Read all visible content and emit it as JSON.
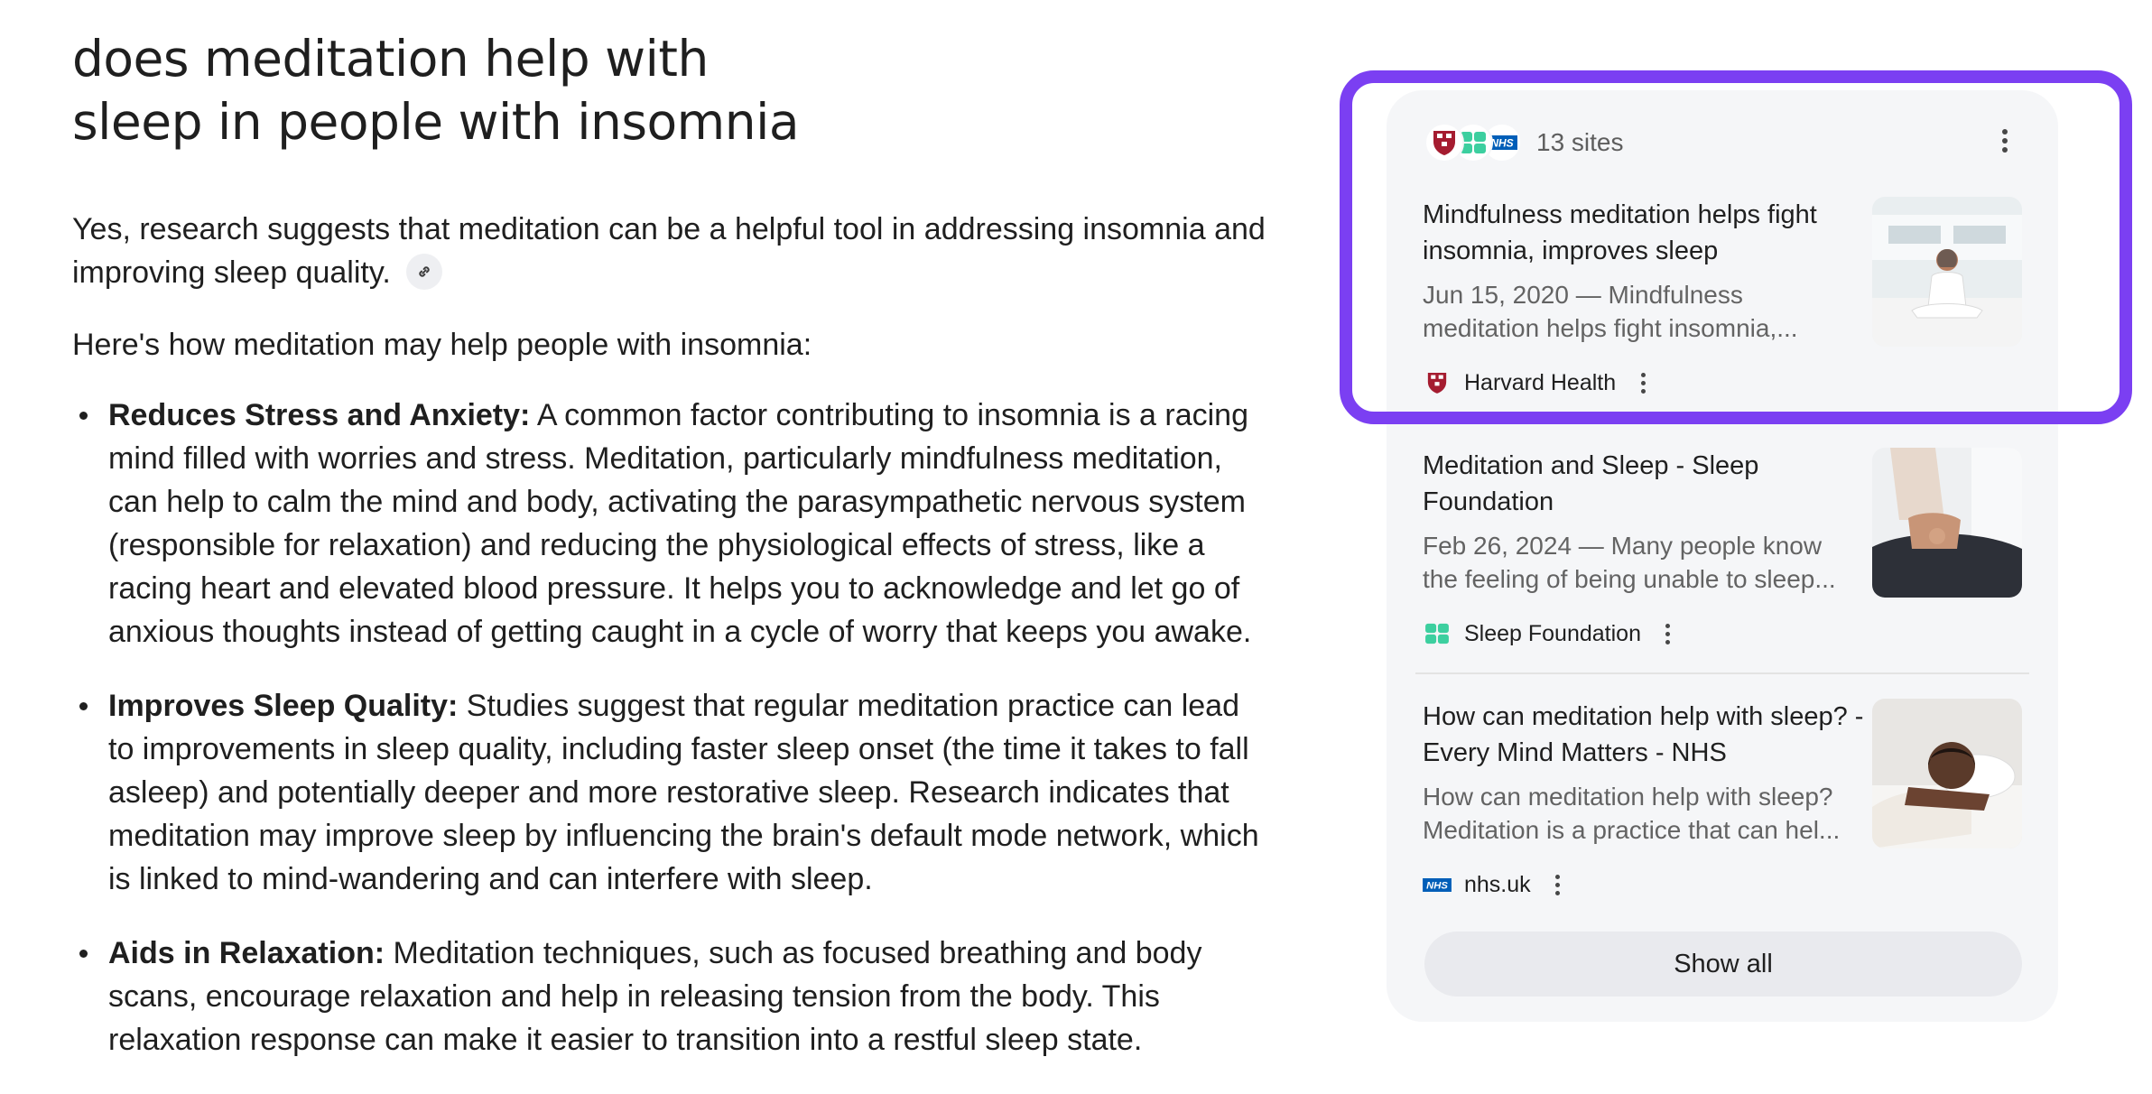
{
  "query": {
    "title_line1": "does meditation help with",
    "title_line2": "sleep in people with insomnia"
  },
  "answer": {
    "intro": "Yes, research suggests that meditation can be a helpful tool in addressing insomnia and improving sleep quality.",
    "lead_in": "Here's how meditation may help people with insomnia:",
    "bullets": [
      {
        "title": "Reduces Stress and Anxiety:",
        "text": " A common factor contributing to insomnia is a racing mind filled with worries and stress. Meditation, particularly mindfulness meditation, can help to calm the mind and body, activating the parasympathetic nervous system (responsible for relaxation) and reducing the physiological effects of stress, like a racing heart and elevated blood pressure. It helps you to acknowledge and let go of anxious thoughts instead of getting caught in a cycle of worry that keeps you awake."
      },
      {
        "title": "Improves Sleep Quality:",
        "text": " Studies suggest that regular meditation practice can lead to improvements in sleep quality, including faster sleep onset (the time it takes to fall asleep) and potentially deeper and more restorative sleep. Research indicates that meditation may improve sleep by influencing the brain's default mode network, which is linked to mind-wandering and can interfere with sleep."
      },
      {
        "title": "Aids in Relaxation:",
        "text": " Meditation techniques, such as focused breathing and body scans, encourage relaxation and help in releasing tension from the body. This relaxation response can make it easier to transition into a restful sleep state."
      }
    ]
  },
  "sources": {
    "count_label": "13 sites",
    "show_all_label": "Show all",
    "cards": [
      {
        "title": "Mindfulness meditation helps fight insomnia, improves sleep",
        "snippet_line1": "Jun 15, 2020 — Mindfulness",
        "snippet_line2": "meditation helps fight insomnia,...",
        "site": "Harvard Health",
        "icon": "harvard-shield-icon"
      },
      {
        "title": "Meditation and Sleep - Sleep Foundation",
        "snippet_line1": "Feb 26, 2024 — Many people know",
        "snippet_line2": "the feeling of being unable to sleep...",
        "site": "Sleep Foundation",
        "icon": "sleep-foundation-icon"
      },
      {
        "title": "How can meditation help with sleep? - Every Mind Matters - NHS",
        "snippet_line1": "How can meditation help with sleep?",
        "snippet_line2": "Meditation is a practice that can hel...",
        "site": "nhs.uk",
        "icon": "nhs-icon"
      }
    ]
  },
  "colors": {
    "highlight": "#7b3ff2",
    "panel_bg": "#f5f6f8",
    "harvard_red": "#a51c30",
    "sleep_foundation_green": "#3ccf9f",
    "nhs_blue": "#005eb8"
  }
}
